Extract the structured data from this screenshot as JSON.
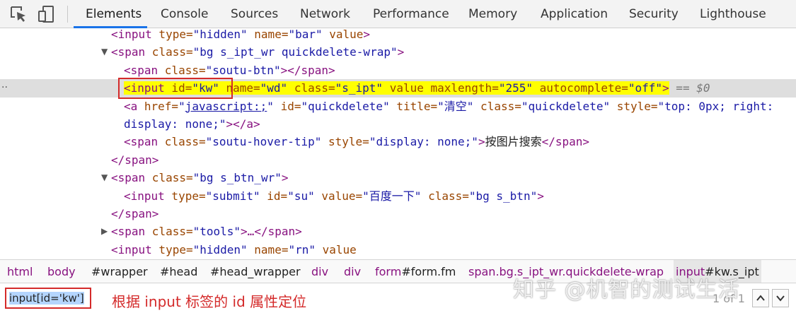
{
  "toolbar": {
    "tabs": [
      "Elements",
      "Console",
      "Sources",
      "Network",
      "Performance",
      "Memory",
      "Application",
      "Security",
      "Lighthouse"
    ],
    "active_tab": "Elements",
    "icons": [
      "inspect-element-icon",
      "device-toolbar-icon"
    ]
  },
  "tree": {
    "line1": {
      "tag": "<input",
      "a1": " type=",
      "v1": "\"hidden\"",
      "a2": " name=",
      "v2": "\"bar\"",
      "a3": " value",
      "close": ">"
    },
    "line2": {
      "caret": "▼",
      "tag": "<span",
      "a1": " class=",
      "v1": "\"bg s_ipt_wr quickdelete-wrap\"",
      "close": ">"
    },
    "line3": {
      "tag": "<span",
      "a1": " class=",
      "v1": "\"soutu-btn\"",
      "close": "></span>"
    },
    "line4": {
      "dots": "··",
      "tag": "<input",
      "a1": " id=",
      "v1": "\"kw\"",
      "a2": " name=",
      "v2": "\"wd\"",
      "a3": " class=",
      "v3": "\"s_ipt\"",
      "a4": " value",
      "a5": " maxlength=",
      "v5": "\"255\"",
      "a6": " autocomplete=",
      "v6": "\"off\"",
      "close": ">",
      "ref": " == $0"
    },
    "line5": {
      "tag": "<a",
      "a1": " href=",
      "q1": "\"",
      "link": "javascript:;",
      "q2": "\"",
      "a2": " id=",
      "v2": "\"quickdelete\"",
      "a3": " title=",
      "v3": "\"清空\"",
      "a4": " class=",
      "v4": "\"quickdelete\"",
      "a5": " style=",
      "v5": "\"top: 0px; right:"
    },
    "line6": {
      "v": "display: none;\"",
      "close": "></a>"
    },
    "line7": {
      "tag": "<span",
      "a1": " class=",
      "v1": "\"soutu-hover-tip\"",
      "a2": " style=",
      "v2": "\"display: none;\"",
      "close": ">",
      "text": "按图片搜索",
      "end": "</span>"
    },
    "line8": {
      "tag": "</span>"
    },
    "line9": {
      "caret": "▼",
      "tag": "<span",
      "a1": " class=",
      "v1": "\"bg s_btn_wr\"",
      "close": ">"
    },
    "line10": {
      "tag": "<input",
      "a1": " type=",
      "v1": "\"submit\"",
      "a2": " id=",
      "v2": "\"su\"",
      "a3": " value=",
      "v3": "\"百度一下\"",
      "a4": " class=",
      "v4": "\"bg s_btn\"",
      "close": ">"
    },
    "line11": {
      "tag": "</span>"
    },
    "line12": {
      "caret": "▶",
      "tag": "<span",
      "a1": " class=",
      "v1": "\"tools\"",
      "close": ">…</span>"
    },
    "line13": {
      "tag": "<input",
      "a1": " type=",
      "v1": "\"hidden\"",
      "a2": " name=",
      "v2": "\"rn\"",
      "a3": " value"
    }
  },
  "breadcrumbs": {
    "items": [
      "html",
      "body",
      "#wrapper",
      "#head",
      "#head_wrapper",
      "div",
      "div"
    ],
    "form_tag": "form",
    "form_id": "#form.fm",
    "span_tag": "span",
    "span_cls": ".bg.s_ipt_wr.quickdelete-wrap",
    "input_tag": "input",
    "input_id": "#kw.s_ipt"
  },
  "search": {
    "query": "input[id='kw']",
    "annotation": "根据 input 标签的 id 属性定位",
    "match_count": "1 of 1",
    "up_label": "⌃",
    "down_label": "⌄"
  },
  "watermark": "知乎 @机智的测试生活",
  "colors": {
    "accent": "#1a73e8",
    "highlight": "#ffff00",
    "annotation_red": "#d42a2a",
    "tag": "#881280",
    "attr": "#994500",
    "value": "#1a1aa6"
  }
}
